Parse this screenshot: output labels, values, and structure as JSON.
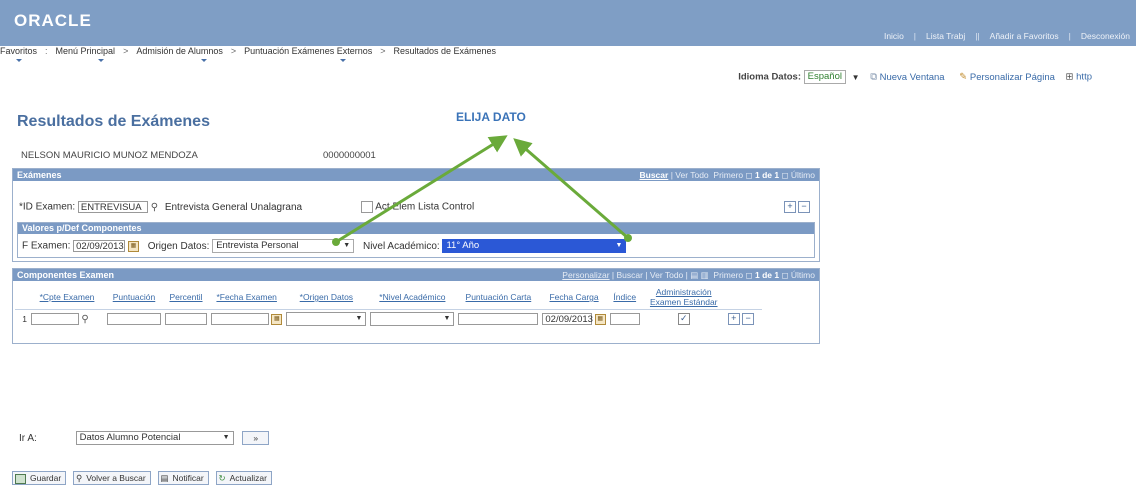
{
  "header": {
    "logo": "ORACLE",
    "links": [
      "Inicio",
      "Lista Trabj",
      "Añadir a Favoritos",
      "Desconexión"
    ]
  },
  "breadcrumb": [
    "Favoritos",
    "Menú Principal",
    "Admisión de Alumnos",
    "Puntuación Exámenes Externos",
    "Resultados de Exámenes"
  ],
  "toolbar": {
    "idioma_label": "Idioma Datos:",
    "idioma_value": "Español",
    "nueva_ventana": "Nueva Ventana",
    "personalizar": "Personalizar Página",
    "http": "http"
  },
  "page": {
    "title": "Resultados de Exámenes",
    "annotation": "ELIJA DATO",
    "student_name": "NELSON MAURICIO MUNOZ MENDOZA",
    "student_id": "0000000001"
  },
  "examenes": {
    "header": "Exámenes",
    "nav": {
      "buscar": "Buscar",
      "ver_todo": "Ver Todo",
      "primero": "Primero",
      "count": "1 de 1",
      "ultimo": "Último"
    },
    "id_label": "*ID Examen:",
    "id_value": "ENTREVISUA",
    "id_desc": "Entrevista General Unalagrana",
    "checkbox_label": "Act Elem Lista Control"
  },
  "valores": {
    "header": "Valores p/Def Componentes",
    "fexamen_label": "F Examen:",
    "fexamen_value": "02/09/2013",
    "origen_label": "Origen Datos:",
    "origen_value": "Entrevista Personal",
    "nivel_label": "Nivel Académico:",
    "nivel_value": "11° Año"
  },
  "componentes": {
    "header": "Componentes Examen",
    "nav": {
      "personalizar": "Personalizar",
      "buscar": "Buscar",
      "ver_todo": "Ver Todo",
      "primero": "Primero",
      "count": "1 de 1",
      "ultimo": "Último"
    },
    "columns": [
      "*Cpte Examen",
      "Puntuación",
      "Percentil",
      "*Fecha Examen",
      "*Origen Datos",
      "*Nivel Académico",
      "Puntuación Carta",
      "Fecha Carga",
      "Índice",
      "Administración Examen Estándar"
    ],
    "row": {
      "num": "1",
      "fecha_carga": "02/09/2013"
    }
  },
  "goto": {
    "label": "Ir A:",
    "value": "Datos Alumno Potencial",
    "btn": "»"
  },
  "buttons": {
    "guardar": "Guardar",
    "volver": "Volver a Buscar",
    "notificar": "Notificar",
    "actualizar": "Actualizar"
  }
}
